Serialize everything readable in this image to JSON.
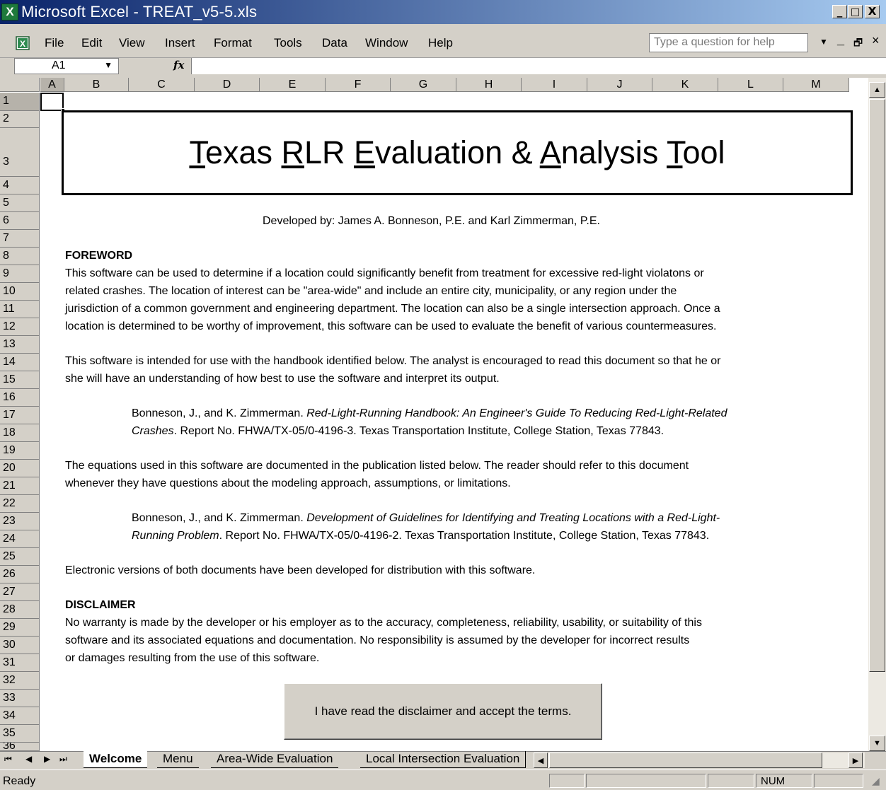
{
  "app": {
    "title": "Microsoft Excel - TREAT_v5-5.xls",
    "icon_name": "excel-icon"
  },
  "window_controls": {
    "minimize": "_",
    "restore": "□",
    "close": "X"
  },
  "menu": {
    "items": [
      "File",
      "Edit",
      "View",
      "Insert",
      "Format",
      "Tools",
      "Data",
      "Window",
      "Help"
    ],
    "help_placeholder": "Type a question for help",
    "doc_controls": {
      "minimize": "_",
      "restore": "🗗",
      "close": "×"
    }
  },
  "formula_bar": {
    "name_box": "A1",
    "fx_label": "fx",
    "formula": ""
  },
  "columns": [
    "A",
    "B",
    "C",
    "D",
    "E",
    "F",
    "G",
    "H",
    "I",
    "J",
    "K",
    "L",
    "M"
  ],
  "rows": [
    "1",
    "2",
    "3",
    "4",
    "5",
    "6",
    "7",
    "8",
    "9",
    "10",
    "11",
    "12",
    "13",
    "14",
    "15",
    "16",
    "17",
    "18",
    "19",
    "20",
    "21",
    "22",
    "23",
    "24",
    "25",
    "26",
    "27",
    "28",
    "29",
    "30",
    "31",
    "32",
    "33",
    "34",
    "35",
    "36"
  ],
  "sheet": {
    "banner": {
      "w1_first": "T",
      "w1_rest": "exas ",
      "w2_first": "R",
      "w2_rest": "LR ",
      "w3_first": "E",
      "w3_rest": "valuation & ",
      "w4_first": "A",
      "w4_rest": "nalysis ",
      "w5_first": "T",
      "w5_rest": "ool"
    },
    "developed_by": "Developed by:  James A. Bonneson, P.E. and Karl Zimmerman, P.E.",
    "foreword_heading": "FOREWORD",
    "foreword_lines": [
      "This software can be used to determine if a location could significantly benefit from treatment for excessive red-light violatons or",
      "related crashes.  The location of interest can be \"area-wide\" and include an entire city, municipality, or any region under the",
      "jurisdiction of a common government and engineering department.  The location can also be a single intersection approach.  Once a",
      "location is determined to be worthy of improvement, this software can be used to evaluate the benefit of various countermeasures."
    ],
    "handbook_lines": [
      "This software is intended for use with the handbook identified below.  The analyst is encouraged to read this document so that he or",
      "she will have an understanding of how best to use the software and interpret its output."
    ],
    "ref1": {
      "authors": "Bonneson, J., and K. Zimmerman.  ",
      "title1": "Red-Light-Running Handbook:  An Engineer's Guide To Reducing Red-Light-Related",
      "title2": "Crashes",
      "rest": ".  Report No. FHWA/TX-05/0-4196-3. Texas Transportation Institute, College Station, Texas 77843."
    },
    "equations_lines": [
      "The equations used in this software are documented in the publication listed below.  The reader should refer to this document",
      "whenever they have questions about the modeling approach, assumptions, or limitations."
    ],
    "ref2": {
      "authors": "Bonneson, J., and K. Zimmerman.  ",
      "title1": "Development of Guidelines for Identifying and Treating Locations with a Red-Light-",
      "title2": "Running Problem",
      "rest": ".  Report No. FHWA/TX-05/0-4196-2. Texas Transportation Institute, College Station, Texas 77843."
    },
    "electronic": "Electronic versions of both documents have been developed for distribution with this software.",
    "disclaimer_heading": "DISCLAIMER",
    "disclaimer_lines": [
      "No warranty is made by the developer or his employer as to the accuracy, completeness, reliability, usability, or suitability of this",
      "software and its associated equations and documentation.  No responsibility is assumed by the developer for incorrect results",
      "or damages resulting from the use of this software."
    ],
    "accept_button": "I have read the disclaimer and accept the terms."
  },
  "tabs": {
    "nav": [
      "⏮",
      "◀",
      "▶",
      "⏭"
    ],
    "items": [
      "Welcome",
      "Menu",
      "Area-Wide Evaluation",
      "Local Intersection Evaluation"
    ],
    "active": "Welcome"
  },
  "status": {
    "text": "Ready",
    "num": "NUM"
  },
  "colors": {
    "titlebar_start": "#0a246a",
    "titlebar_end": "#a6caf0",
    "chrome": "#d4d0c8"
  }
}
